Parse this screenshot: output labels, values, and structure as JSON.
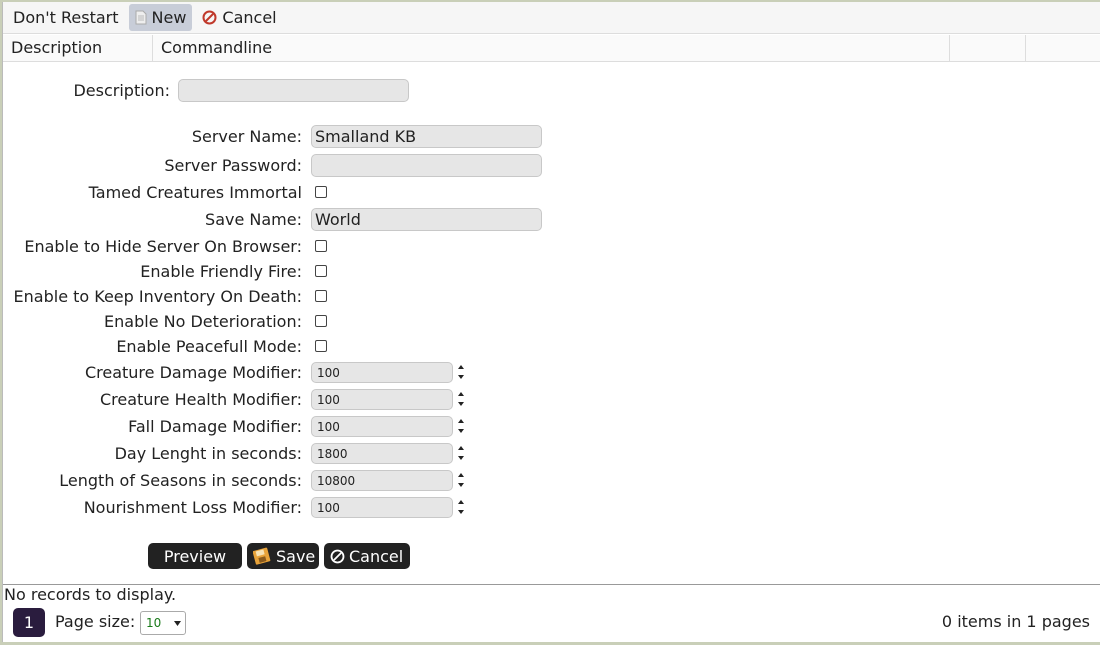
{
  "toolbar": {
    "dont_restart_label": "Don't Restart",
    "new_label": "New",
    "cancel_label": "Cancel"
  },
  "grid": {
    "columns": [
      "Description",
      "Commandline",
      "",
      ""
    ]
  },
  "form": {
    "description_label": "Description:",
    "description_value": "",
    "server_name_label": "Server Name:",
    "server_name_value": "Smalland KB",
    "server_password_label": "Server Password:",
    "server_password_value": "",
    "tamed_label": "Tamed Creatures Immortal",
    "save_name_label": "Save Name:",
    "save_name_value": "World",
    "hide_server_label": "Enable to Hide Server On Browser:",
    "friendly_fire_label": "Enable Friendly Fire:",
    "keep_inventory_label": "Enable to Keep Inventory On Death:",
    "no_deterioration_label": "Enable No Deterioration:",
    "peaceful_label": "Enable Peacefull Mode:",
    "creature_damage_label": "Creature Damage Modifier:",
    "creature_damage_value": "100",
    "creature_health_label": "Creature Health Modifier:",
    "creature_health_value": "100",
    "fall_damage_label": "Fall Damage Modifier:",
    "fall_damage_value": "100",
    "day_length_label": "Day Lenght in seconds:",
    "day_length_value": "1800",
    "season_length_label": "Length of Seasons in seconds:",
    "season_length_value": "10800",
    "nourishment_label": "Nourishment Loss Modifier:",
    "nourishment_value": "100",
    "preview_label": "Preview",
    "save_label": "Save",
    "cancel_label": "Cancel"
  },
  "footer": {
    "no_records": "No records to display.",
    "page_number": "1",
    "page_size_label": "Page size:",
    "page_size_value": "10",
    "items_count": "0 items in 1 pages"
  },
  "colors": {
    "accent_dark": "#222222",
    "pager_active": "#2a1c3e",
    "cancel_icon": "#c0392b"
  },
  "icons": {
    "new": "document-icon",
    "cancel": "cancel-circle-icon",
    "save": "floppy-disk-icon"
  }
}
